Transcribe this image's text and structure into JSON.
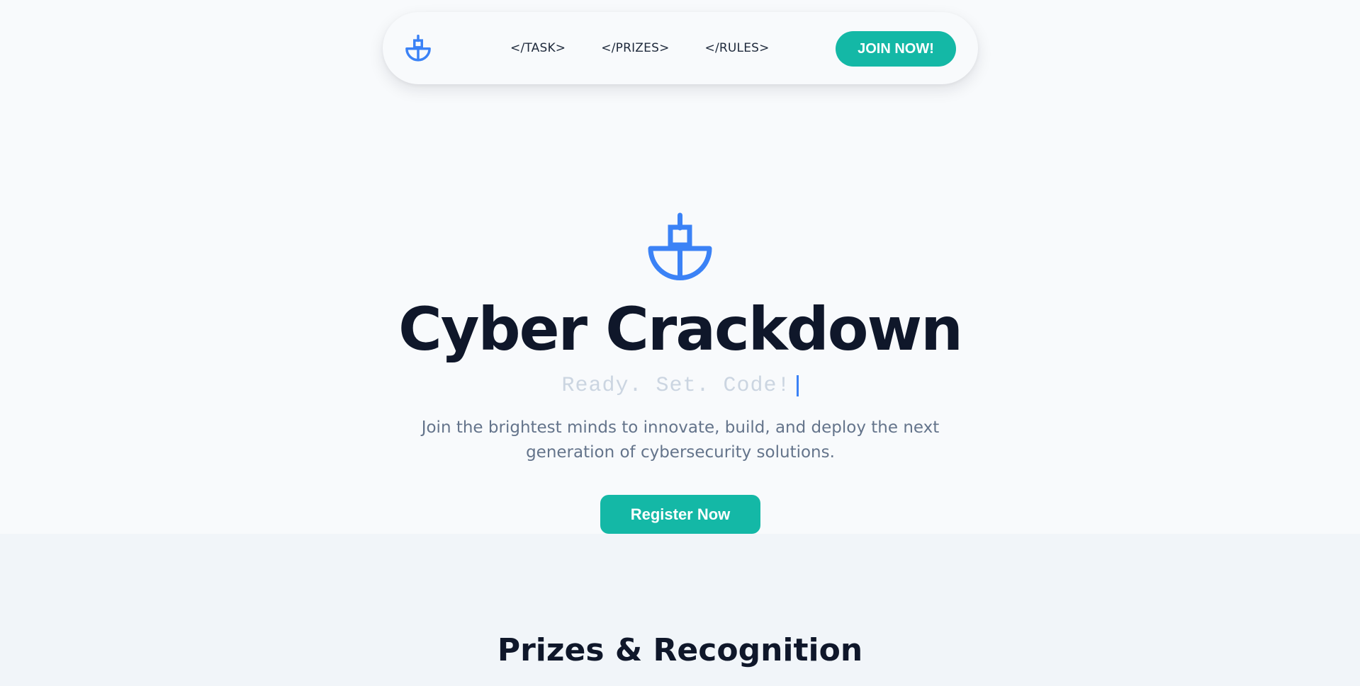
{
  "nav": {
    "logo_icon": "plug-shield-icon",
    "links": [
      "</TASK>",
      "</PRIZES>",
      "</RULES>"
    ],
    "join_label": "JOIN NOW!"
  },
  "hero": {
    "logo_icon": "plug-shield-icon",
    "title": "Cyber Crackdown",
    "tagline": "Ready. Set. Code!",
    "description": "Join the brightest minds to innovate, build, and deploy the next generation of cybersecurity solutions.",
    "register_label": "Register Now"
  },
  "prizes": {
    "title": "Prizes & Recognition"
  },
  "colors": {
    "accent": "#14b8a6",
    "brand_blue": "#3b82f6",
    "background": "#f8fafc",
    "section_background": "#f1f5f9",
    "heading": "#0f172a",
    "muted_text": "#64748b"
  }
}
